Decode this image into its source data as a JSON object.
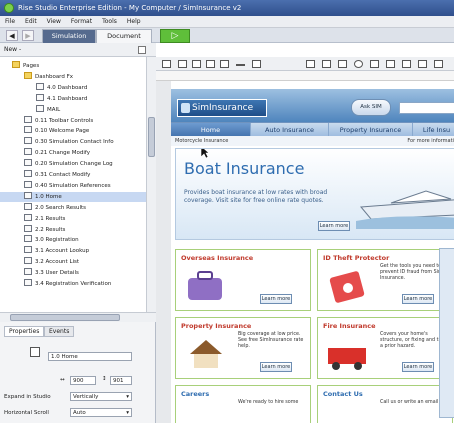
{
  "window": {
    "title": "Rise Studio Enterprise Edition - My Computer / SimInsurance v2"
  },
  "menu": [
    "File",
    "Edit",
    "View",
    "Format",
    "Tools",
    "Help"
  ],
  "tabs": {
    "simulation": "Simulation",
    "document": "Document"
  },
  "left_toolbar": {
    "new_label": "New -"
  },
  "tree": {
    "items": [
      {
        "label": "Pages",
        "indent": 1,
        "type": "folder"
      },
      {
        "label": "Dashboard Fx",
        "indent": 2,
        "type": "folder"
      },
      {
        "label": "4.0 Dashboard",
        "indent": 3,
        "type": "page"
      },
      {
        "label": "4.1 Dashboard",
        "indent": 3,
        "type": "page"
      },
      {
        "label": "MAIL",
        "indent": 3,
        "type": "page"
      },
      {
        "label": "0.11 Toolbar Controls",
        "indent": 2,
        "type": "page"
      },
      {
        "label": "0.10 Welcome Page",
        "indent": 2,
        "type": "page"
      },
      {
        "label": "0.30 Simulation Contact Info",
        "indent": 2,
        "type": "page"
      },
      {
        "label": "0.21 Change Modify",
        "indent": 2,
        "type": "page"
      },
      {
        "label": "0.20 Simulation Change Log",
        "indent": 2,
        "type": "page"
      },
      {
        "label": "0.31 Contact Modify",
        "indent": 2,
        "type": "page"
      },
      {
        "label": "0.40 Simulation References",
        "indent": 2,
        "type": "page"
      },
      {
        "label": "1.0 Home",
        "indent": 2,
        "type": "page",
        "selected": true
      },
      {
        "label": "2.0 Search Results",
        "indent": 2,
        "type": "page"
      },
      {
        "label": "2.1 Results",
        "indent": 2,
        "type": "page"
      },
      {
        "label": "2.2 Results",
        "indent": 2,
        "type": "page"
      },
      {
        "label": "3.0 Registration",
        "indent": 2,
        "type": "page"
      },
      {
        "label": "3.1 Account Lookup",
        "indent": 2,
        "type": "page"
      },
      {
        "label": "3.2 Account List",
        "indent": 2,
        "type": "page"
      },
      {
        "label": "3.3 User Details",
        "indent": 2,
        "type": "page"
      },
      {
        "label": "3.4 Registration Verification",
        "indent": 2,
        "type": "page"
      }
    ]
  },
  "properties": {
    "tab_properties": "Properties",
    "tab_events": "Events",
    "name_value": "1.0 Home",
    "width_value": "900",
    "height_value": "901",
    "expand_label": "Expand in Studio",
    "expand_value": "Vertically",
    "hscroll_label": "Horizontal Scroll",
    "hscroll_value": "Auto"
  },
  "site": {
    "logo": "SimInsurance",
    "ask_label": "Ask SIM",
    "nav": [
      "Home",
      "Auto Insurance",
      "Property Insurance",
      "Life Insu"
    ],
    "breadcrumb_left": "Motorcycle Insurance",
    "breadcrumb_right": "For more informatio",
    "hero_title": "Boat Insurance",
    "hero_text": "Provides boat insurance at low rates with broad coverage. Visit site for free online rate quotes.",
    "learn_more": "Learn more",
    "panels": [
      {
        "title": "Overseas Insurance",
        "body": "",
        "color": "red"
      },
      {
        "title": "ID Theft Protector",
        "body": "Get the tools you need to prevent ID fraud from Sim Insurance.",
        "color": "red"
      },
      {
        "title": "Property Insurance",
        "body": "Big coverage at low price. See free SimInsurance rate help.",
        "color": "red"
      },
      {
        "title": "Fire Insurance",
        "body": "Covers your home's structure, or fixing and title a prior hazard.",
        "color": "red"
      },
      {
        "title": "Careers",
        "body": "We're ready to hire some",
        "color": "blue"
      },
      {
        "title": "Contact Us",
        "body": "Call us or write an email",
        "color": "blue"
      }
    ]
  }
}
